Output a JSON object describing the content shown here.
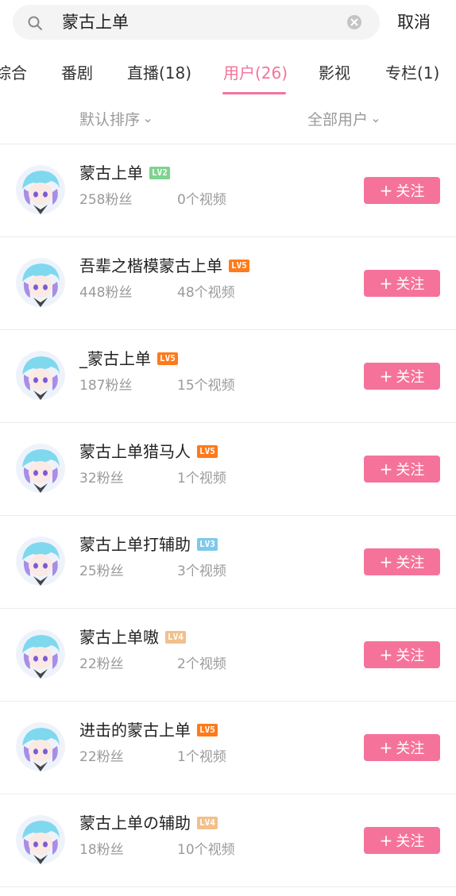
{
  "search": {
    "query": "蒙古上单",
    "cancel_label": "取消"
  },
  "tabs": [
    {
      "label": "综合"
    },
    {
      "label": "番剧"
    },
    {
      "label": "直播(18)"
    },
    {
      "label": "用户(26)"
    },
    {
      "label": "影视"
    },
    {
      "label": "专栏(1)"
    }
  ],
  "active_tab": "用户(26)",
  "sort": {
    "order_label": "默认排序",
    "filter_label": "全部用户"
  },
  "follow_label": "关注",
  "follow_plus": "+",
  "level_colors": {
    "LV2": "#7dd38f",
    "LV3": "#7ec9ea",
    "LV4": "#f2c08b",
    "LV5": "#ff7a1a"
  },
  "accent_color": "#f5739b",
  "users": [
    {
      "name": "蒙古上单",
      "level": "LV2",
      "fans": "258粉丝",
      "videos": "0个视频"
    },
    {
      "name": "吾辈之楷模蒙古上单",
      "level": "LV5",
      "fans": "448粉丝",
      "videos": "48个视频"
    },
    {
      "name": "_蒙古上单",
      "level": "LV5",
      "fans": "187粉丝",
      "videos": "15个视频"
    },
    {
      "name": "蒙古上单猎马人",
      "level": "LV5",
      "fans": "32粉丝",
      "videos": "1个视频"
    },
    {
      "name": "蒙古上单打辅助",
      "level": "LV3",
      "fans": "25粉丝",
      "videos": "3个视频"
    },
    {
      "name": "蒙古上单嗷",
      "level": "LV4",
      "fans": "22粉丝",
      "videos": "2个视频"
    },
    {
      "name": "进击的蒙古上单",
      "level": "LV5",
      "fans": "22粉丝",
      "videos": "1个视频"
    },
    {
      "name": "蒙古上单の辅助",
      "level": "LV4",
      "fans": "18粉丝",
      "videos": "10个视频"
    }
  ]
}
